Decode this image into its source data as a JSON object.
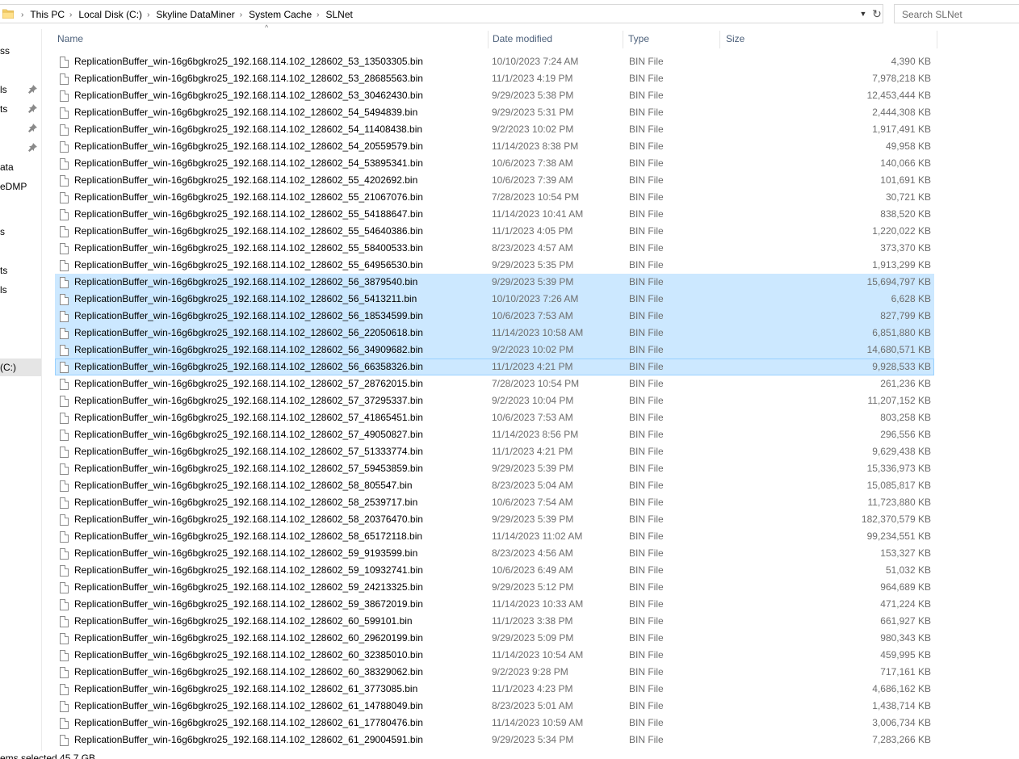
{
  "address": {
    "breadcrumbs": [
      "This PC",
      "Local Disk (C:)",
      "Skyline DataMiner",
      "System Cache",
      "SLNet"
    ],
    "dropdown_icon": "chevron-down-icon",
    "refresh_icon": "refresh-icon"
  },
  "search": {
    "placeholder": "Search SLNet"
  },
  "nav": {
    "items": [
      {
        "label": "ss",
        "pinned": false
      },
      {
        "label": "ls",
        "pinned": true
      },
      {
        "label": "ts",
        "pinned": true
      },
      {
        "label": "",
        "pinned": true
      },
      {
        "label": "",
        "pinned": true
      },
      {
        "label": "ata",
        "pinned": false
      },
      {
        "label": "eDMP",
        "pinned": false
      },
      {
        "label": "s",
        "pinned": false
      },
      {
        "label": "ts",
        "pinned": false
      },
      {
        "label": "ls",
        "pinned": false
      },
      {
        "label": "(C:)",
        "pinned": false,
        "active": true
      }
    ]
  },
  "columns": {
    "name": "Name",
    "date": "Date modified",
    "type": "Type",
    "size": "Size"
  },
  "files": [
    {
      "name": "ReplicationBuffer_win-16g6bgkro25_192.168.114.102_128602_53_13503305.bin",
      "date": "10/10/2023 7:24 AM",
      "type": "BIN File",
      "size": "4,390 KB",
      "selected": false
    },
    {
      "name": "ReplicationBuffer_win-16g6bgkro25_192.168.114.102_128602_53_28685563.bin",
      "date": "11/1/2023 4:19 PM",
      "type": "BIN File",
      "size": "7,978,218 KB",
      "selected": false
    },
    {
      "name": "ReplicationBuffer_win-16g6bgkro25_192.168.114.102_128602_53_30462430.bin",
      "date": "9/29/2023 5:38 PM",
      "type": "BIN File",
      "size": "12,453,444 KB",
      "selected": false
    },
    {
      "name": "ReplicationBuffer_win-16g6bgkro25_192.168.114.102_128602_54_5494839.bin",
      "date": "9/29/2023 5:31 PM",
      "type": "BIN File",
      "size": "2,444,308 KB",
      "selected": false
    },
    {
      "name": "ReplicationBuffer_win-16g6bgkro25_192.168.114.102_128602_54_11408438.bin",
      "date": "9/2/2023 10:02 PM",
      "type": "BIN File",
      "size": "1,917,491 KB",
      "selected": false
    },
    {
      "name": "ReplicationBuffer_win-16g6bgkro25_192.168.114.102_128602_54_20559579.bin",
      "date": "11/14/2023 8:38 PM",
      "type": "BIN File",
      "size": "49,958 KB",
      "selected": false
    },
    {
      "name": "ReplicationBuffer_win-16g6bgkro25_192.168.114.102_128602_54_53895341.bin",
      "date": "10/6/2023 7:38 AM",
      "type": "BIN File",
      "size": "140,066 KB",
      "selected": false
    },
    {
      "name": "ReplicationBuffer_win-16g6bgkro25_192.168.114.102_128602_55_4202692.bin",
      "date": "10/6/2023 7:39 AM",
      "type": "BIN File",
      "size": "101,691 KB",
      "selected": false
    },
    {
      "name": "ReplicationBuffer_win-16g6bgkro25_192.168.114.102_128602_55_21067076.bin",
      "date": "7/28/2023 10:54 PM",
      "type": "BIN File",
      "size": "30,721 KB",
      "selected": false
    },
    {
      "name": "ReplicationBuffer_win-16g6bgkro25_192.168.114.102_128602_55_54188647.bin",
      "date": "11/14/2023 10:41 AM",
      "type": "BIN File",
      "size": "838,520 KB",
      "selected": false
    },
    {
      "name": "ReplicationBuffer_win-16g6bgkro25_192.168.114.102_128602_55_54640386.bin",
      "date": "11/1/2023 4:05 PM",
      "type": "BIN File",
      "size": "1,220,022 KB",
      "selected": false
    },
    {
      "name": "ReplicationBuffer_win-16g6bgkro25_192.168.114.102_128602_55_58400533.bin",
      "date": "8/23/2023 4:57 AM",
      "type": "BIN File",
      "size": "373,370 KB",
      "selected": false
    },
    {
      "name": "ReplicationBuffer_win-16g6bgkro25_192.168.114.102_128602_55_64956530.bin",
      "date": "9/29/2023 5:35 PM",
      "type": "BIN File",
      "size": "1,913,299 KB",
      "selected": false
    },
    {
      "name": "ReplicationBuffer_win-16g6bgkro25_192.168.114.102_128602_56_3879540.bin",
      "date": "9/29/2023 5:39 PM",
      "type": "BIN File",
      "size": "15,694,797 KB",
      "selected": true
    },
    {
      "name": "ReplicationBuffer_win-16g6bgkro25_192.168.114.102_128602_56_5413211.bin",
      "date": "10/10/2023 7:26 AM",
      "type": "BIN File",
      "size": "6,628 KB",
      "selected": true
    },
    {
      "name": "ReplicationBuffer_win-16g6bgkro25_192.168.114.102_128602_56_18534599.bin",
      "date": "10/6/2023 7:53 AM",
      "type": "BIN File",
      "size": "827,799 KB",
      "selected": true
    },
    {
      "name": "ReplicationBuffer_win-16g6bgkro25_192.168.114.102_128602_56_22050618.bin",
      "date": "11/14/2023 10:58 AM",
      "type": "BIN File",
      "size": "6,851,880 KB",
      "selected": true
    },
    {
      "name": "ReplicationBuffer_win-16g6bgkro25_192.168.114.102_128602_56_34909682.bin",
      "date": "9/2/2023 10:02 PM",
      "type": "BIN File",
      "size": "14,680,571 KB",
      "selected": true
    },
    {
      "name": "ReplicationBuffer_win-16g6bgkro25_192.168.114.102_128602_56_66358326.bin",
      "date": "11/1/2023 4:21 PM",
      "type": "BIN File",
      "size": "9,928,533 KB",
      "selected": true,
      "focused": true
    },
    {
      "name": "ReplicationBuffer_win-16g6bgkro25_192.168.114.102_128602_57_28762015.bin",
      "date": "7/28/2023 10:54 PM",
      "type": "BIN File",
      "size": "261,236 KB",
      "selected": false
    },
    {
      "name": "ReplicationBuffer_win-16g6bgkro25_192.168.114.102_128602_57_37295337.bin",
      "date": "9/2/2023 10:04 PM",
      "type": "BIN File",
      "size": "11,207,152 KB",
      "selected": false
    },
    {
      "name": "ReplicationBuffer_win-16g6bgkro25_192.168.114.102_128602_57_41865451.bin",
      "date": "10/6/2023 7:53 AM",
      "type": "BIN File",
      "size": "803,258 KB",
      "selected": false
    },
    {
      "name": "ReplicationBuffer_win-16g6bgkro25_192.168.114.102_128602_57_49050827.bin",
      "date": "11/14/2023 8:56 PM",
      "type": "BIN File",
      "size": "296,556 KB",
      "selected": false
    },
    {
      "name": "ReplicationBuffer_win-16g6bgkro25_192.168.114.102_128602_57_51333774.bin",
      "date": "11/1/2023 4:21 PM",
      "type": "BIN File",
      "size": "9,629,438 KB",
      "selected": false
    },
    {
      "name": "ReplicationBuffer_win-16g6bgkro25_192.168.114.102_128602_57_59453859.bin",
      "date": "9/29/2023 5:39 PM",
      "type": "BIN File",
      "size": "15,336,973 KB",
      "selected": false
    },
    {
      "name": "ReplicationBuffer_win-16g6bgkro25_192.168.114.102_128602_58_805547.bin",
      "date": "8/23/2023 5:04 AM",
      "type": "BIN File",
      "size": "15,085,817 KB",
      "selected": false
    },
    {
      "name": "ReplicationBuffer_win-16g6bgkro25_192.168.114.102_128602_58_2539717.bin",
      "date": "10/6/2023 7:54 AM",
      "type": "BIN File",
      "size": "11,723,880 KB",
      "selected": false
    },
    {
      "name": "ReplicationBuffer_win-16g6bgkro25_192.168.114.102_128602_58_20376470.bin",
      "date": "9/29/2023 5:39 PM",
      "type": "BIN File",
      "size": "182,370,579 KB",
      "selected": false
    },
    {
      "name": "ReplicationBuffer_win-16g6bgkro25_192.168.114.102_128602_58_65172118.bin",
      "date": "11/14/2023 11:02 AM",
      "type": "BIN File",
      "size": "99,234,551 KB",
      "selected": false
    },
    {
      "name": "ReplicationBuffer_win-16g6bgkro25_192.168.114.102_128602_59_9193599.bin",
      "date": "8/23/2023 4:56 AM",
      "type": "BIN File",
      "size": "153,327 KB",
      "selected": false
    },
    {
      "name": "ReplicationBuffer_win-16g6bgkro25_192.168.114.102_128602_59_10932741.bin",
      "date": "10/6/2023 6:49 AM",
      "type": "BIN File",
      "size": "51,032 KB",
      "selected": false
    },
    {
      "name": "ReplicationBuffer_win-16g6bgkro25_192.168.114.102_128602_59_24213325.bin",
      "date": "9/29/2023 5:12 PM",
      "type": "BIN File",
      "size": "964,689 KB",
      "selected": false
    },
    {
      "name": "ReplicationBuffer_win-16g6bgkro25_192.168.114.102_128602_59_38672019.bin",
      "date": "11/14/2023 10:33 AM",
      "type": "BIN File",
      "size": "471,224 KB",
      "selected": false
    },
    {
      "name": "ReplicationBuffer_win-16g6bgkro25_192.168.114.102_128602_60_599101.bin",
      "date": "11/1/2023 3:38 PM",
      "type": "BIN File",
      "size": "661,927 KB",
      "selected": false
    },
    {
      "name": "ReplicationBuffer_win-16g6bgkro25_192.168.114.102_128602_60_29620199.bin",
      "date": "9/29/2023 5:09 PM",
      "type": "BIN File",
      "size": "980,343 KB",
      "selected": false
    },
    {
      "name": "ReplicationBuffer_win-16g6bgkro25_192.168.114.102_128602_60_32385010.bin",
      "date": "11/14/2023 10:54 AM",
      "type": "BIN File",
      "size": "459,995 KB",
      "selected": false
    },
    {
      "name": "ReplicationBuffer_win-16g6bgkro25_192.168.114.102_128602_60_38329062.bin",
      "date": "9/2/2023 9:28 PM",
      "type": "BIN File",
      "size": "717,161 KB",
      "selected": false
    },
    {
      "name": "ReplicationBuffer_win-16g6bgkro25_192.168.114.102_128602_61_3773085.bin",
      "date": "11/1/2023 4:23 PM",
      "type": "BIN File",
      "size": "4,686,162 KB",
      "selected": false
    },
    {
      "name": "ReplicationBuffer_win-16g6bgkro25_192.168.114.102_128602_61_14788049.bin",
      "date": "8/23/2023 5:01 AM",
      "type": "BIN File",
      "size": "1,438,714 KB",
      "selected": false
    },
    {
      "name": "ReplicationBuffer_win-16g6bgkro25_192.168.114.102_128602_61_17780476.bin",
      "date": "11/14/2023 10:59 AM",
      "type": "BIN File",
      "size": "3,006,734 KB",
      "selected": false
    },
    {
      "name": "ReplicationBuffer_win-16g6bgkro25_192.168.114.102_128602_61_29004591.bin",
      "date": "9/29/2023 5:34 PM",
      "type": "BIN File",
      "size": "7,283,266 KB",
      "selected": false
    }
  ],
  "status": {
    "text": "ems selected  45.7 GB"
  },
  "colors": {
    "selection": "#cce8ff",
    "selection_border": "#99d1ff",
    "header_text": "#4c607a",
    "folder": "#f8d775"
  }
}
